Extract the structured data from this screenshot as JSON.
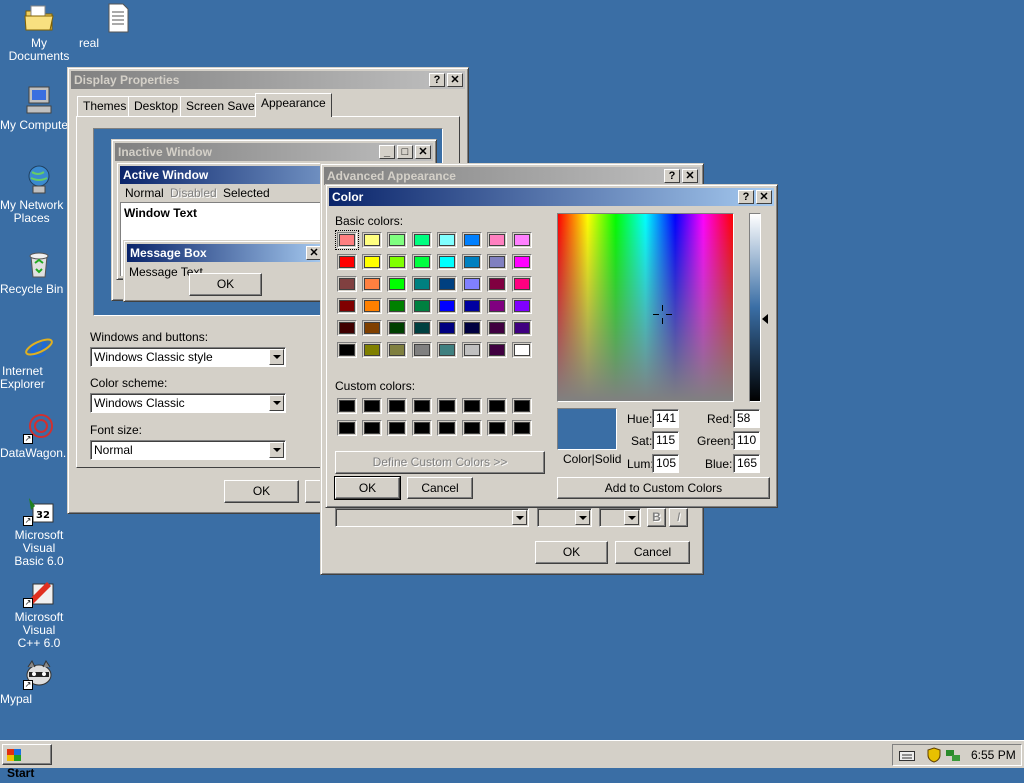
{
  "desktop": {
    "icons": [
      {
        "label": "My Documents",
        "icon": "folder-documents-icon"
      },
      {
        "label": "real",
        "icon": "text-file-icon"
      },
      {
        "label": "My Compute",
        "icon": "computer-icon"
      },
      {
        "label": "My Network\nPlaces",
        "icon": "network-places-icon"
      },
      {
        "label": "Recycle Bin",
        "icon": "recycle-bin-icon"
      },
      {
        "label": "Internet\nExplorer",
        "icon": "internet-explorer-icon"
      },
      {
        "label": "DataWagon.",
        "icon": "datawagon-icon"
      },
      {
        "label": "Microsoft Visual\nBasic 6.0",
        "icon": "visual-basic-icon"
      },
      {
        "label": "Microsoft Visual\nC++ 6.0",
        "icon": "visual-cpp-icon"
      },
      {
        "label": "Mypal",
        "icon": "mypal-icon"
      }
    ]
  },
  "display_properties": {
    "title": "Display Properties",
    "tabs": [
      "Themes",
      "Desktop",
      "Screen Saver",
      "Appearance"
    ],
    "selected_tab": "Appearance",
    "preview": {
      "inactive_title": "Inactive Window",
      "active_title": "Active Window",
      "menu_normal": "Normal",
      "menu_disabled": "Disabled",
      "menu_selected": "Selected",
      "window_text": "Window Text",
      "msgbox_title": "Message Box",
      "msgbox_text": "Message Text",
      "msgbox_ok": "OK"
    },
    "windows_buttons_label": "Windows and buttons:",
    "windows_buttons_value": "Windows Classic style",
    "color_scheme_label": "Color scheme:",
    "color_scheme_value": "Windows Classic",
    "font_size_label": "Font size:",
    "font_size_value": "Normal",
    "ok_label": "OK"
  },
  "advanced_appearance": {
    "title": "Advanced Appearance",
    "bold_label": "B",
    "italic_label": "I",
    "ok_label": "OK",
    "cancel_label": "Cancel"
  },
  "color_dialog": {
    "title": "Color",
    "basic_colors_label": "Basic colors:",
    "custom_colors_label": "Custom colors:",
    "define_custom_label": "Define Custom Colors >>",
    "ok_label": "OK",
    "cancel_label": "Cancel",
    "add_custom_label": "Add to Custom Colors",
    "color_solid_label": "Color|Solid",
    "hue_label": "Hue:",
    "hue_value": "141",
    "sat_label": "Sat:",
    "sat_value": "115",
    "lum_label": "Lum:",
    "lum_value": "105",
    "red_label": "Red:",
    "red_value": "58",
    "green_label": "Green:",
    "green_value": "110",
    "blue_label": "Blue:",
    "blue_value": "165",
    "selected_color": "#3a6ea5",
    "basic_colors": [
      "#ff8080",
      "#ffff80",
      "#80ff80",
      "#00ff80",
      "#80ffff",
      "#0080ff",
      "#ff80c0",
      "#ff80ff",
      "#ff0000",
      "#ffff00",
      "#80ff00",
      "#00ff40",
      "#00ffff",
      "#0080c0",
      "#8080c0",
      "#ff00ff",
      "#804040",
      "#ff8040",
      "#00ff00",
      "#008080",
      "#004080",
      "#8080ff",
      "#800040",
      "#ff0080",
      "#800000",
      "#ff8000",
      "#008000",
      "#008040",
      "#0000ff",
      "#0000a0",
      "#800080",
      "#8000ff",
      "#400000",
      "#804000",
      "#004000",
      "#004040",
      "#000080",
      "#000040",
      "#400040",
      "#400080",
      "#000000",
      "#808000",
      "#808040",
      "#808080",
      "#408080",
      "#c0c0c0",
      "#400040",
      "#ffffff"
    ],
    "custom_colors": [
      "#000000",
      "#000000",
      "#000000",
      "#000000",
      "#000000",
      "#000000",
      "#000000",
      "#000000",
      "#000000",
      "#000000",
      "#000000",
      "#000000",
      "#000000",
      "#000000",
      "#000000",
      "#000000"
    ]
  },
  "taskbar": {
    "start_label": "Start",
    "clock": "6:55 PM"
  }
}
